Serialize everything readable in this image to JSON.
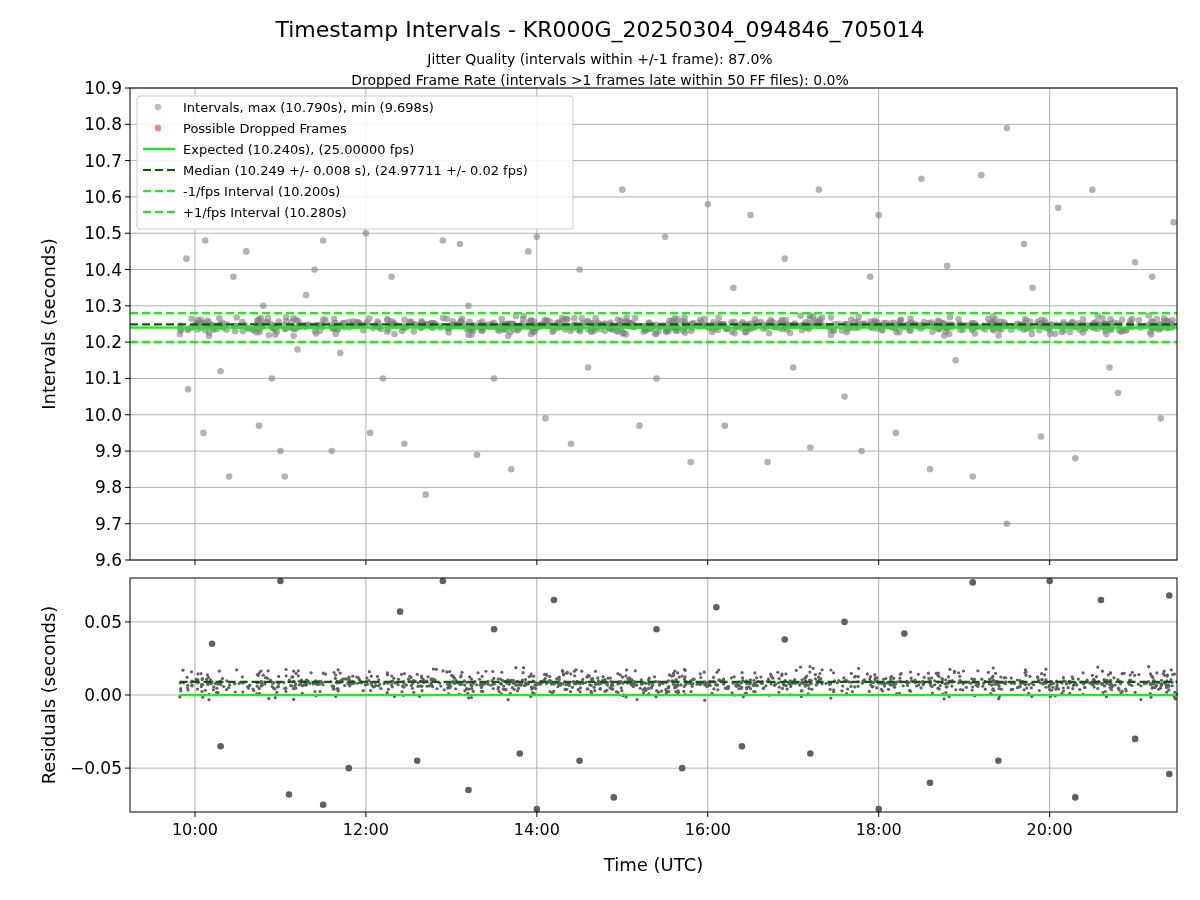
{
  "figure": {
    "title": "Timestamp Intervals - KR000G_20250304_094846_705014",
    "subtitles": [
      "Jitter Quality (intervals within +/-1 frame): 87.0%",
      "Dropped Frame Rate (intervals >1 frames late within 50 FF files): 0.0%"
    ]
  },
  "intervals_panel": {
    "chart_data": {
      "type": "scatter",
      "ylabel": "Intervals (seconds)",
      "xlim": [
        9.24,
        21.49
      ],
      "ylim": [
        9.6,
        10.9
      ],
      "grid": true,
      "legend": true,
      "yticks": [
        {
          "value": 9.6,
          "label": "9.6"
        },
        {
          "value": 9.7,
          "label": "9.7"
        },
        {
          "value": 9.8,
          "label": "9.8"
        },
        {
          "value": 9.9,
          "label": "9.9"
        },
        {
          "value": 10.0,
          "label": "10.0"
        },
        {
          "value": 10.1,
          "label": "10.1"
        },
        {
          "value": 10.2,
          "label": "10.2"
        },
        {
          "value": 10.3,
          "label": "10.3"
        },
        {
          "value": 10.4,
          "label": "10.4"
        },
        {
          "value": 10.5,
          "label": "10.5"
        },
        {
          "value": 10.6,
          "label": "10.6"
        },
        {
          "value": 10.7,
          "label": "10.7"
        },
        {
          "value": 10.8,
          "label": "10.8"
        },
        {
          "value": 10.9,
          "label": "10.9"
        }
      ],
      "series": [
        {
          "name": "Intervals, max (10.790s), min (9.698s)",
          "type": "scatter",
          "color": "#808080",
          "x": [
            9.9,
            9.92,
            10.1,
            10.12,
            10.4,
            10.45,
            10.6,
            10.75,
            10.9,
            11.0,
            11.05,
            11.2,
            11.3,
            11.5,
            11.6,
            11.7,
            12.0,
            12.05,
            12.2,
            12.45,
            12.7,
            12.9,
            13.1,
            13.3,
            13.5,
            13.7,
            13.9,
            14.0,
            14.1,
            14.4,
            14.6,
            15.0,
            15.2,
            15.5,
            15.8,
            16.0,
            16.2,
            16.5,
            16.7,
            16.9,
            17.2,
            17.3,
            17.6,
            17.8,
            18.0,
            18.2,
            18.5,
            18.6,
            18.8,
            19.1,
            19.2,
            19.5,
            19.5,
            19.7,
            19.9,
            20.1,
            20.3,
            20.5,
            20.8,
            21.0,
            21.3,
            21.45,
            10.3,
            10.8,
            11.4,
            12.3,
            13.2,
            14.5,
            15.4,
            16.3,
            17.0,
            17.9,
            18.9,
            19.8,
            20.7,
            21.2
          ],
          "values": [
            10.43,
            10.07,
            9.95,
            10.48,
            9.83,
            10.38,
            10.45,
            9.97,
            10.1,
            9.9,
            9.83,
            10.18,
            10.33,
            10.48,
            9.9,
            10.17,
            10.5,
            9.95,
            10.1,
            9.92,
            9.78,
            10.48,
            10.47,
            9.89,
            10.1,
            9.85,
            10.45,
            10.49,
            9.99,
            9.92,
            10.13,
            10.62,
            9.97,
            10.49,
            9.87,
            10.58,
            9.97,
            10.55,
            9.87,
            10.43,
            9.91,
            10.62,
            10.05,
            9.9,
            10.55,
            9.95,
            10.65,
            9.85,
            10.41,
            9.83,
            10.66,
            10.79,
            9.7,
            10.47,
            9.94,
            10.57,
            9.88,
            10.62,
            10.06,
            10.42,
            9.99,
            10.53,
            10.12,
            10.3,
            10.4,
            10.38,
            10.3,
            10.4,
            10.1,
            10.35,
            10.13,
            10.38,
            10.15,
            10.35,
            10.13,
            10.38
          ]
        },
        {
          "name": "Possible Dropped Frames",
          "type": "scatter",
          "color": "#ff0000"
        },
        {
          "name": "Expected (10.240s), (25.00000 fps)",
          "type": "line",
          "line_style": "solid",
          "color": "#00ff00",
          "x": [
            9.24,
            21.49
          ],
          "values": [
            10.24,
            10.24
          ]
        },
        {
          "name": "Median (10.249 +/- 0.008 s), (24.97711 +/- 0.02 fps)",
          "type": "line",
          "line_style": "dashed",
          "color": "#006400",
          "x": [
            9.24,
            21.49
          ],
          "values": [
            10.249,
            10.249
          ]
        },
        {
          "name": "-1/fps Interval (10.200s)",
          "type": "line",
          "line_style": "dashed",
          "color": "#00ff00",
          "x": [
            9.24,
            21.49
          ],
          "values": [
            10.2,
            10.2
          ]
        },
        {
          "name": "+1/fps Interval (10.280s)",
          "type": "line",
          "line_style": "dashed",
          "color": "#00ff00",
          "x": [
            9.24,
            21.49
          ],
          "values": [
            10.28,
            10.28
          ]
        }
      ]
    }
  },
  "residuals_panel": {
    "chart_data": {
      "type": "scatter",
      "xlabel": "Time (UTC)",
      "ylabel": "Residuals (seconds)",
      "xlim": [
        9.24,
        21.49
      ],
      "ylim": [
        -0.08,
        0.08
      ],
      "grid": true,
      "xticks": [
        {
          "value": 10,
          "label": "10:00"
        },
        {
          "value": 12,
          "label": "12:00"
        },
        {
          "value": 14,
          "label": "14:00"
        },
        {
          "value": 16,
          "label": "16:00"
        },
        {
          "value": 18,
          "label": "18:00"
        },
        {
          "value": 20,
          "label": "20:00"
        }
      ],
      "yticks": [
        {
          "value": -0.05,
          "label": "−0.05"
        },
        {
          "value": 0,
          "label": "0.00"
        },
        {
          "value": 0.05,
          "label": "0.05"
        }
      ],
      "series": [
        {
          "type": "scatter",
          "color": "#606060",
          "x": [
            10.2,
            10.3,
            11.0,
            11.1,
            11.5,
            11.8,
            12.4,
            12.6,
            12.9,
            13.2,
            13.5,
            13.8,
            14.0,
            14.2,
            14.5,
            14.9,
            15.4,
            15.7,
            16.1,
            16.4,
            16.9,
            17.2,
            17.6,
            18.0,
            18.3,
            18.6,
            19.1,
            19.4,
            20.0,
            20.3,
            20.6,
            21.0,
            21.4,
            21.4
          ],
          "values": [
            0.035,
            -0.035,
            0.078,
            -0.068,
            -0.075,
            -0.05,
            0.057,
            -0.045,
            0.078,
            -0.065,
            0.045,
            -0.04,
            -0.078,
            0.065,
            -0.045,
            -0.07,
            0.045,
            -0.05,
            0.06,
            -0.035,
            0.038,
            -0.04,
            0.05,
            -0.078,
            0.042,
            -0.06,
            0.077,
            -0.045,
            0.078,
            -0.07,
            0.065,
            -0.03,
            0.068,
            -0.054
          ]
        },
        {
          "type": "line",
          "line_style": "dashed",
          "color": "#006400",
          "x": [
            9.82,
            21.49
          ],
          "values": [
            0.009,
            0.009
          ]
        },
        {
          "type": "line",
          "line_style": "solid",
          "color": "#00ff00",
          "x": [
            9.82,
            21.49
          ],
          "values": [
            0,
            0
          ]
        }
      ]
    }
  }
}
